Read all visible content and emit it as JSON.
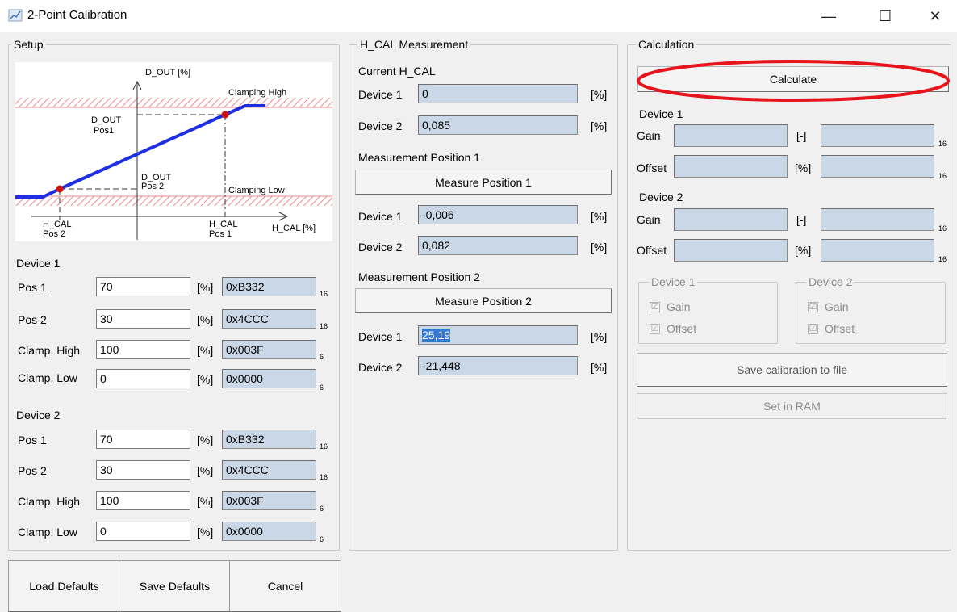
{
  "window": {
    "title": "2-Point Calibration",
    "icon": "calibration-app-icon",
    "controls": {
      "minimize": "—",
      "maximize": "☐",
      "close": "✕"
    }
  },
  "setup": {
    "title": "Setup",
    "diagram": {
      "y_axis": "D_OUT [%]",
      "x_axis": "H_CAL [%]",
      "clamping_high": "Clamping High",
      "clamping_low": "Clamping Low",
      "d_out_pos1": [
        "D_OUT",
        "Pos1"
      ],
      "d_out_pos2": [
        "D_OUT",
        "Pos 2"
      ],
      "h_cal_pos2": [
        "H_CAL",
        "Pos 2"
      ],
      "h_cal_pos1": [
        "H_CAL",
        "Pos 1"
      ]
    },
    "device1": {
      "heading": "Device 1",
      "rows": [
        {
          "label": "Pos 1",
          "value": "70",
          "unit": "[%]",
          "hex": "0xB332",
          "sub": "16"
        },
        {
          "label": "Pos 2",
          "value": "30",
          "unit": "[%]",
          "hex": "0x4CCC",
          "sub": "16"
        },
        {
          "label": "Clamp. High",
          "value": "100",
          "unit": "[%]",
          "hex": "0x003F",
          "sub": "6"
        },
        {
          "label": "Clamp. Low",
          "value": "0",
          "unit": "[%]",
          "hex": "0x0000",
          "sub": "6"
        }
      ]
    },
    "device2": {
      "heading": "Device 2",
      "rows": [
        {
          "label": "Pos 1",
          "value": "70",
          "unit": "[%]",
          "hex": "0xB332",
          "sub": "16"
        },
        {
          "label": "Pos 2",
          "value": "30",
          "unit": "[%]",
          "hex": "0x4CCC",
          "sub": "16"
        },
        {
          "label": "Clamp. High",
          "value": "100",
          "unit": "[%]",
          "hex": "0x003F",
          "sub": "6"
        },
        {
          "label": "Clamp. Low",
          "value": "0",
          "unit": "[%]",
          "hex": "0x0000",
          "sub": "6"
        }
      ]
    }
  },
  "measurement": {
    "title": "H_CAL Measurement",
    "current_heading": "Current H_CAL",
    "current": [
      {
        "label": "Device 1",
        "value": "0",
        "unit": "[%]"
      },
      {
        "label": "Device 2",
        "value": "0,085",
        "unit": "[%]"
      }
    ],
    "pos1_heading": "Measurement Position 1",
    "pos1_button": "Measure Position 1",
    "pos1": [
      {
        "label": "Device 1",
        "value": "-0,006",
        "unit": "[%]"
      },
      {
        "label": "Device 2",
        "value": "0,082",
        "unit": "[%]"
      }
    ],
    "pos2_heading": "Measurement Position 2",
    "pos2_button": "Measure Position 2",
    "pos2": [
      {
        "label": "Device 1",
        "value": "25,19",
        "unit": "[%]"
      },
      {
        "label": "Device 2",
        "value": "-21,448",
        "unit": "[%]"
      }
    ]
  },
  "calculation": {
    "title": "Calculation",
    "calculate_button": "Calculate",
    "highlight_color": "#e8141c",
    "device1": {
      "heading": "Device 1",
      "gain_label": "Gain",
      "gain_unit": "[-]",
      "gain_value": "",
      "gain_hex": "",
      "offset_label": "Offset",
      "offset_unit": "[%]",
      "offset_value": "",
      "offset_hex": "",
      "sub": "16"
    },
    "device2": {
      "heading": "Device 2",
      "gain_label": "Gain",
      "gain_unit": "[-]",
      "gain_value": "",
      "gain_hex": "",
      "offset_label": "Offset",
      "offset_unit": "[%]",
      "offset_value": "",
      "offset_hex": "",
      "sub": "16"
    },
    "apply_device1": {
      "title": "Device 1",
      "gain": "Gain",
      "offset": "Offset"
    },
    "apply_device2": {
      "title": "Device 2",
      "gain": "Gain",
      "offset": "Offset"
    },
    "checkbox_mark": "☑",
    "save_button": "Save calibration to file",
    "ram_button": "Set in RAM"
  },
  "bottom": {
    "load_defaults": "Load Defaults",
    "save_defaults": "Save Defaults",
    "cancel": "Cancel"
  },
  "colors": {
    "background": "#f0f0f0",
    "readonly_field": "#c9d7e6",
    "line": "#1f2ee0",
    "point": "#cc1111",
    "hatch": "#ee8a8a"
  }
}
